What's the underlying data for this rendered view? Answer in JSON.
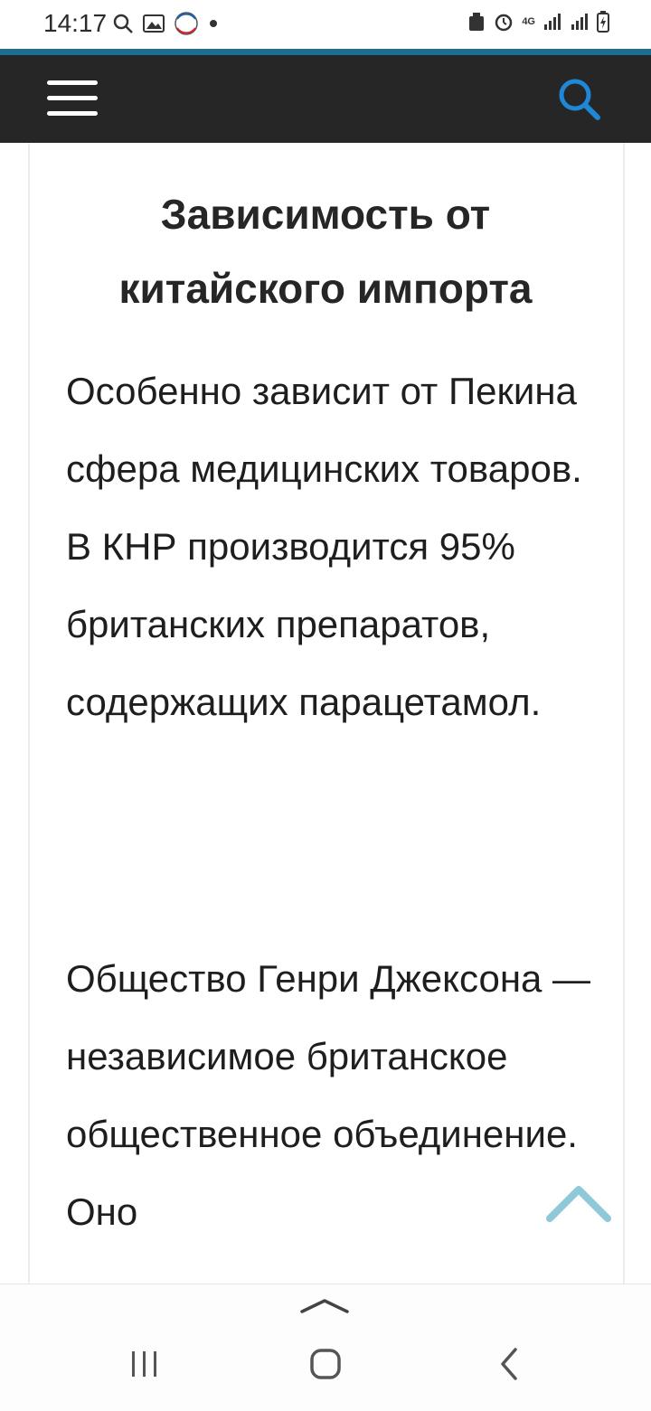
{
  "status_bar": {
    "time": "14:17",
    "left_icons": [
      "search-icon",
      "gallery-icon",
      "gosuslugi-icon",
      "dot-icon"
    ],
    "right_icons": [
      "recycle-icon",
      "alarm-icon",
      "network-4g-icon",
      "signal-icon",
      "signal-icon",
      "battery-icon"
    ],
    "network_label": "4G"
  },
  "header": {
    "background": "#262626",
    "accent": "#1d6e8f",
    "search_icon_color": "#1e88d6",
    "menu_icon": "hamburger-menu-icon",
    "search_icon": "search-icon"
  },
  "article": {
    "heading": "Зависимость от китайского импорта",
    "paragraphs": [
      "Особенно зависит от Пекина сфера медицинских товаров. В КНР производится 95% британских препаратов, содержащих парацетамол.",
      "Общество Генри Джексона — независимое британское общественное объединение. Оно"
    ]
  },
  "scroll_top_icon": "chevron-up-icon",
  "scroll_top_color": "#8fc9d9",
  "nav_bar": {
    "handle_icon": "chevron-up-icon",
    "buttons": [
      "recent-apps-icon",
      "home-icon",
      "back-icon"
    ]
  }
}
